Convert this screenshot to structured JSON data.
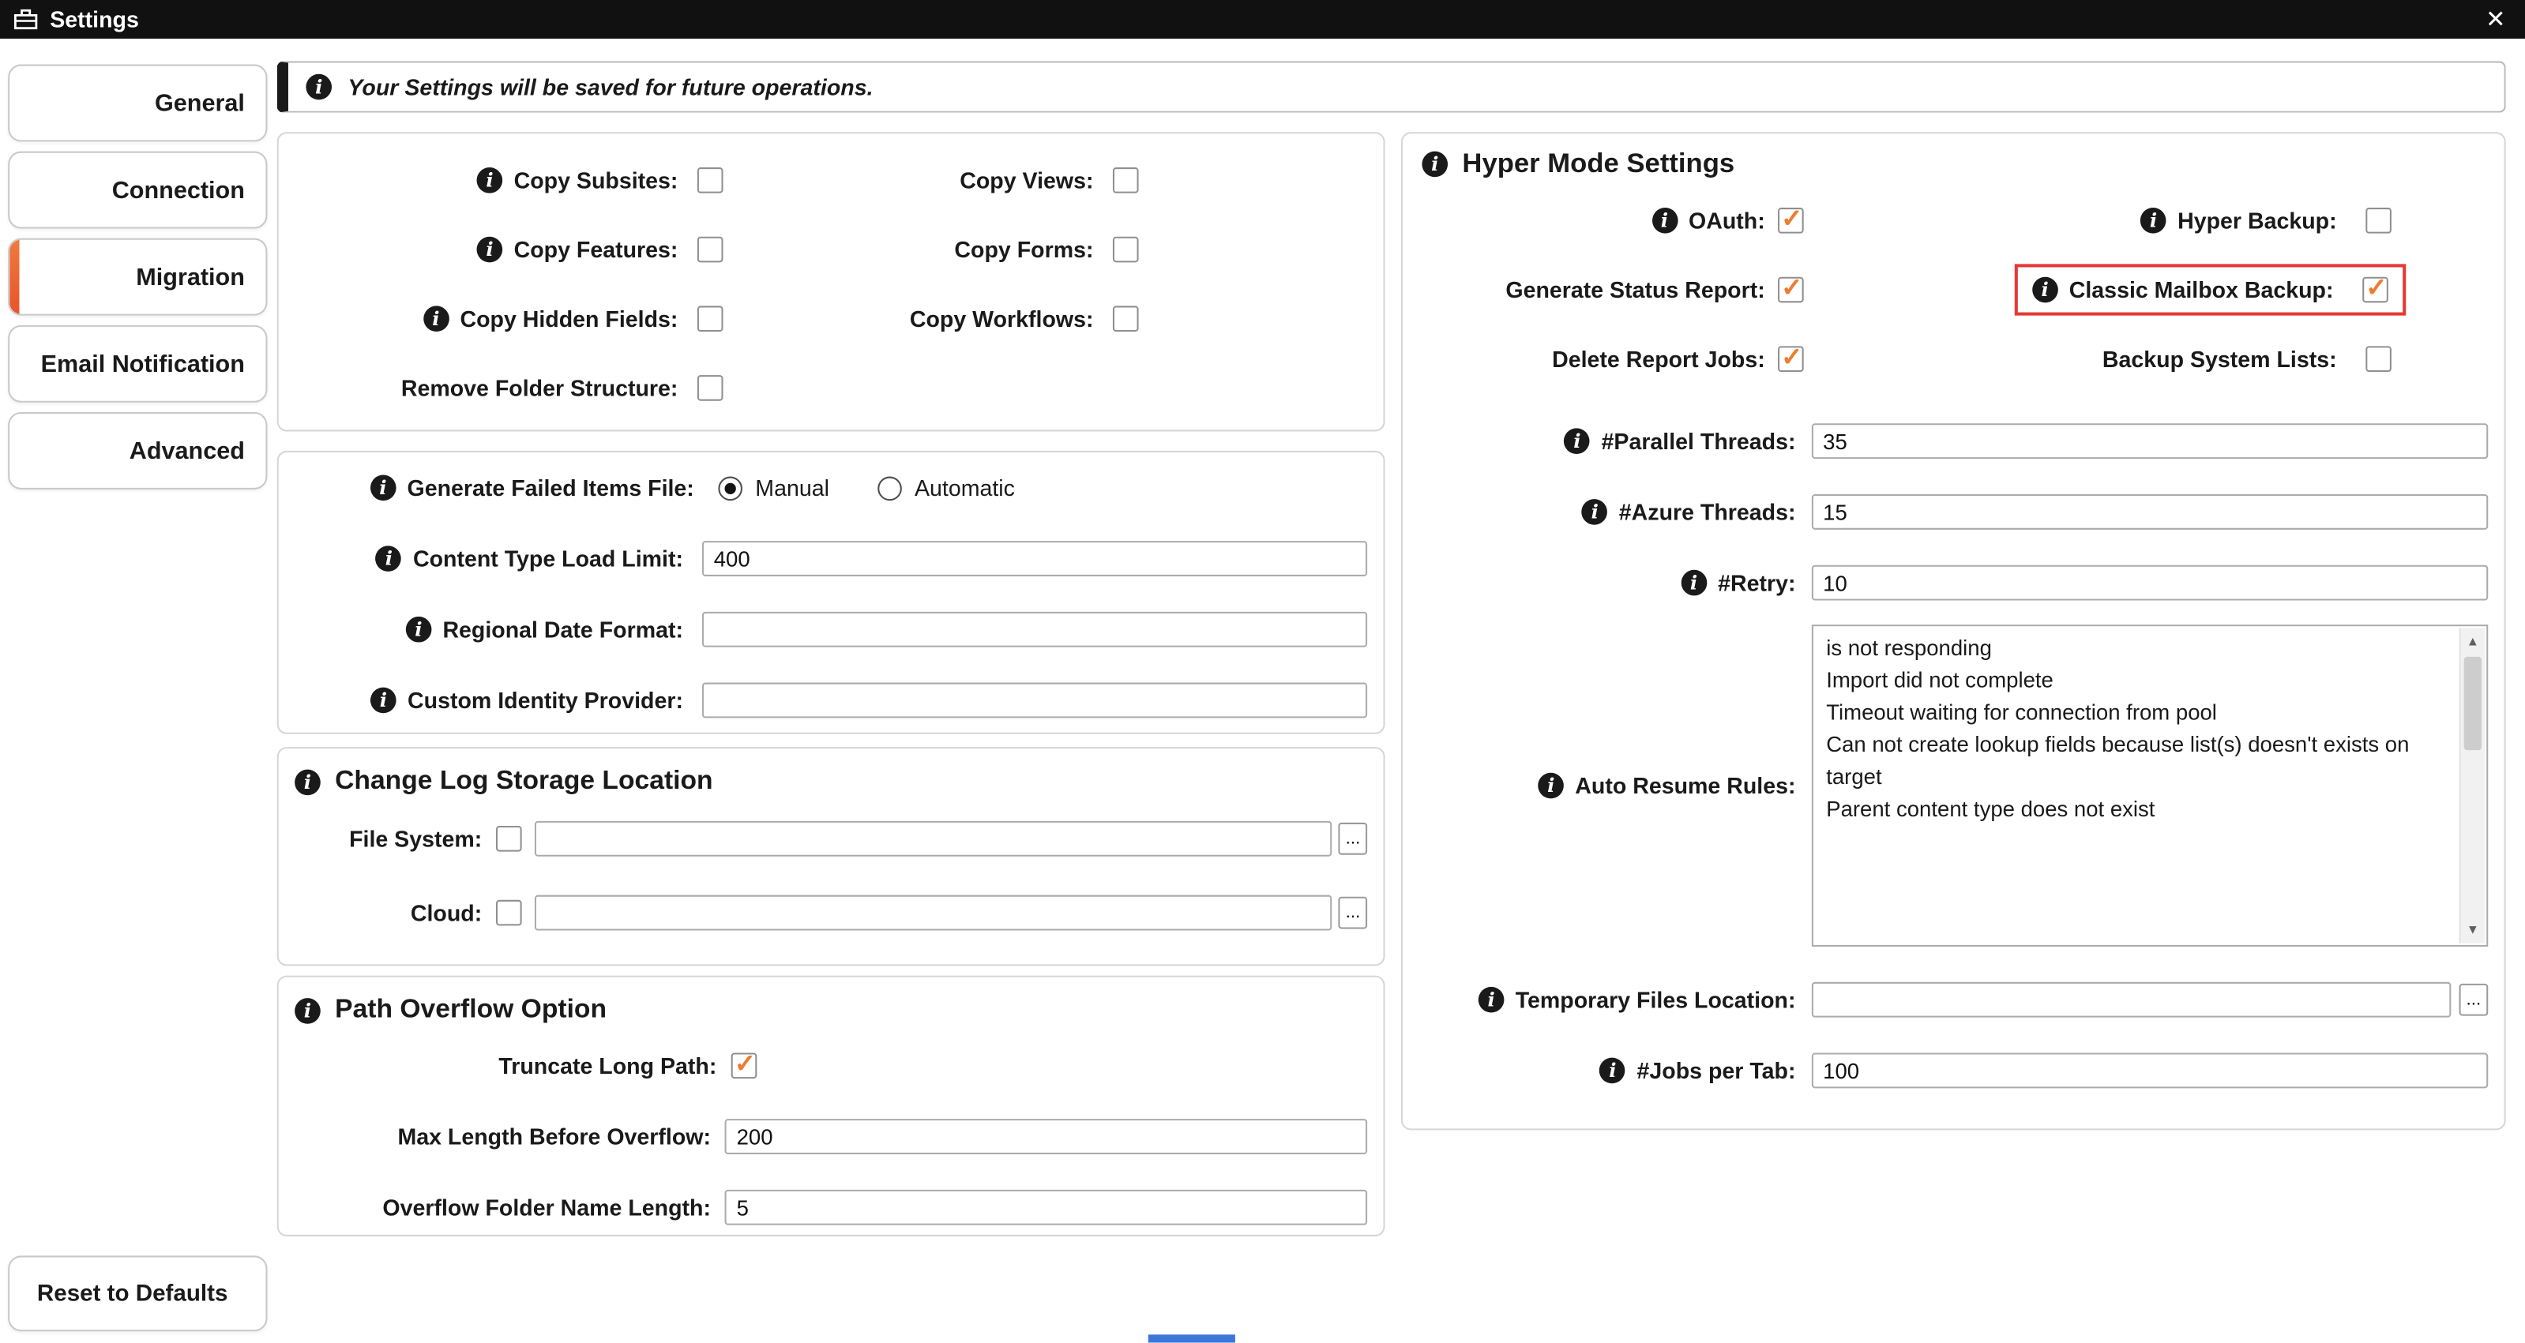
{
  "window": {
    "title": "Settings",
    "close_glyph": "✕"
  },
  "banner": {
    "text": "Your Settings will be saved for future operations."
  },
  "sidebar": {
    "tabs": [
      {
        "label": "General",
        "selected": false
      },
      {
        "label": "Connection",
        "selected": false
      },
      {
        "label": "Migration",
        "selected": true
      },
      {
        "label": "Email Notification",
        "selected": false
      },
      {
        "label": "Advanced",
        "selected": false
      }
    ],
    "reset_button_label": "Reset to Defaults"
  },
  "copy_options": {
    "rows": [
      {
        "left_label": "Copy Subsites:",
        "left_checked": false,
        "right_label": "Copy Views:",
        "right_checked": false
      },
      {
        "left_label": "Copy Features:",
        "left_checked": false,
        "right_label": "Copy Forms:",
        "right_checked": false
      },
      {
        "left_label": "Copy Hidden Fields:",
        "left_checked": false,
        "right_label": "Copy Workflows:",
        "right_checked": false
      },
      {
        "left_label": "Remove Folder Structure:",
        "left_checked": false
      }
    ]
  },
  "general_fields": {
    "failed_items": {
      "label": "Generate Failed Items File:",
      "options": [
        {
          "label": "Manual",
          "selected": true
        },
        {
          "label": "Automatic",
          "selected": false
        }
      ]
    },
    "content_type_load_limit": {
      "label": "Content Type Load Limit:",
      "value": "400"
    },
    "regional_date_format": {
      "label": "Regional Date Format:",
      "value": ""
    },
    "custom_identity_provider": {
      "label": "Custom Identity Provider:",
      "value": ""
    }
  },
  "change_log": {
    "title": "Change Log Storage Location",
    "rows": [
      {
        "label": "File System:",
        "checked": false,
        "value": "",
        "browse_label": "..."
      },
      {
        "label": "Cloud:",
        "checked": false,
        "value": "",
        "browse_label": "..."
      }
    ]
  },
  "path_overflow": {
    "title": "Path Overflow Option",
    "truncate_long_path": {
      "label": "Truncate Long Path:",
      "checked": true
    },
    "max_length_before_overflow": {
      "label": "Max Length Before Overflow:",
      "value": "200"
    },
    "overflow_folder_name_length": {
      "label": "Overflow Folder Name Length:",
      "value": "5"
    }
  },
  "hyper_mode": {
    "title": "Hyper Mode Settings",
    "check_rows": [
      {
        "left_label": "OAuth:",
        "left_checked": true,
        "right_label": "Hyper Backup:",
        "right_checked": false,
        "right_highlight": false
      },
      {
        "left_label": "Generate Status Report:",
        "left_checked": true,
        "right_label": "Classic Mailbox Backup:",
        "right_checked": true,
        "right_highlight": true
      },
      {
        "left_label": "Delete Report Jobs:",
        "left_checked": true,
        "right_label": "Backup System Lists:",
        "right_checked": false,
        "right_highlight": false
      }
    ],
    "parallel_threads": {
      "label": "#Parallel Threads:",
      "value": "35"
    },
    "azure_threads": {
      "label": "#Azure Threads:",
      "value": "15"
    },
    "retry": {
      "label": "#Retry:",
      "value": "10"
    },
    "auto_resume_rules": {
      "label": "Auto Resume Rules:",
      "value": "is not responding\nImport did not complete\nTimeout waiting for connection from pool\nCan not create lookup fields because list(s) doesn't exists on target\nParent content type does not exist"
    },
    "temporary_files_location": {
      "label": "Temporary Files Location:",
      "value": "",
      "browse_label": "..."
    },
    "jobs_per_tab": {
      "label": "#Jobs per Tab:",
      "value": "100"
    }
  },
  "colors": {
    "accent_orange": "#ED7D31",
    "tab_accent": "#E8542C",
    "highlight_red": "#E53935",
    "titlebar": "#111111",
    "taskbar_blue": "#3A77D8"
  }
}
